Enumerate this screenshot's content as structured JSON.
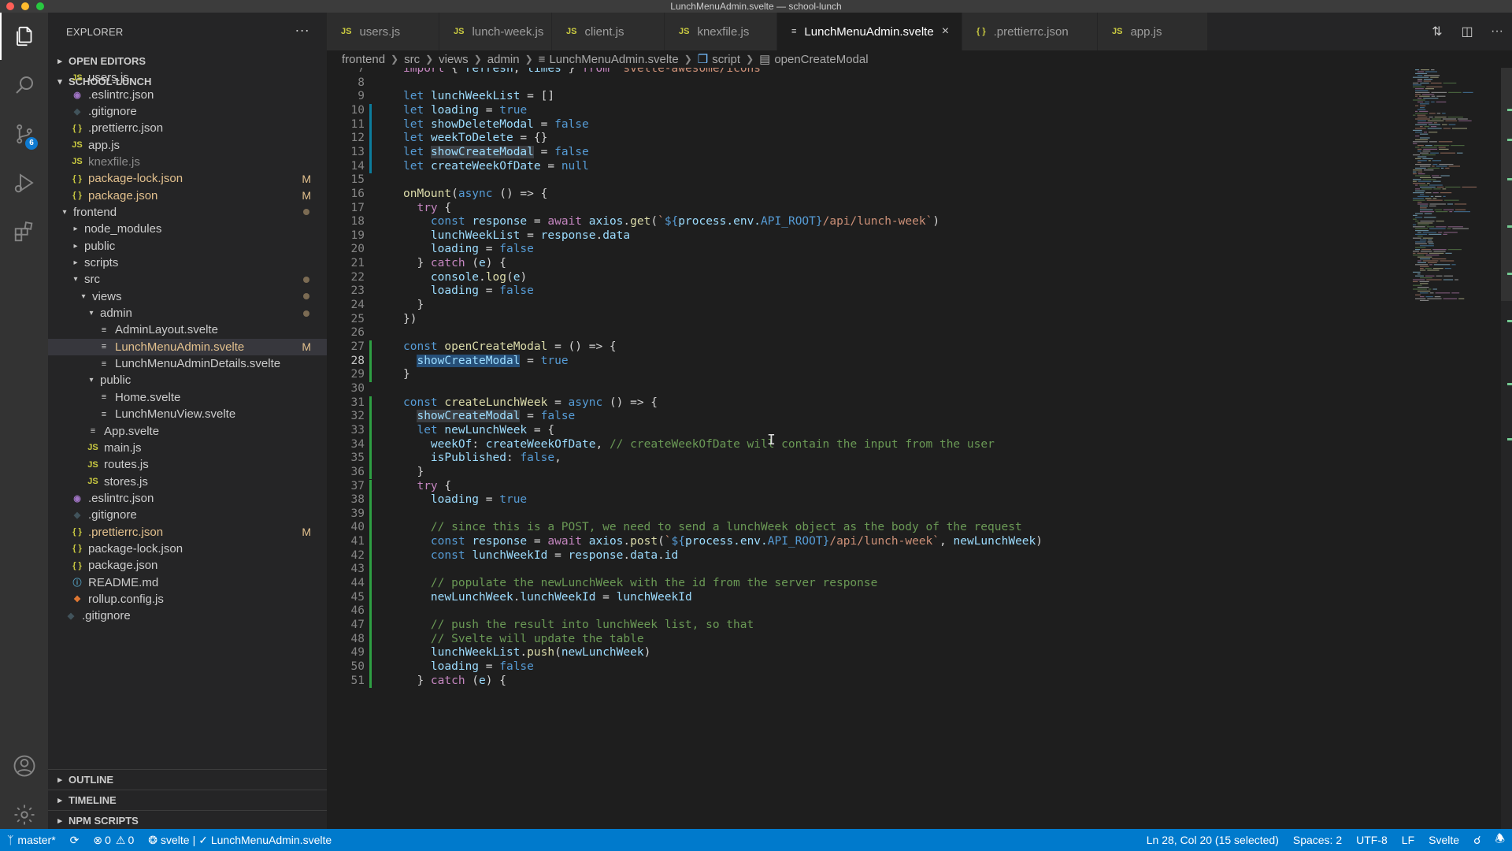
{
  "window": {
    "title": "LunchMenuAdmin.svelte — school-lunch"
  },
  "sidebar": {
    "title": "EXPLORER",
    "sections": {
      "open_editors": "OPEN EDITORS",
      "project": "SCHOOL-LUNCH",
      "outline": "OUTLINE",
      "timeline": "TIMELINE",
      "npm_scripts": "NPM SCRIPTS"
    },
    "tree": [
      {
        "label": "users.js",
        "icon": "js-icon",
        "mark": ""
      },
      {
        "label": ".eslintrc.json",
        "icon": "eslint-icon",
        "mark": ""
      },
      {
        "label": ".gitignore",
        "icon": "git-icon",
        "mark": ""
      },
      {
        "label": ".prettierrc.json",
        "icon": "json-icon",
        "mark": ""
      },
      {
        "label": "app.js",
        "icon": "js-icon",
        "mark": ""
      },
      {
        "label": "knexfile.js",
        "icon": "js-icon",
        "mark": ""
      },
      {
        "label": "package-lock.json",
        "icon": "json-icon",
        "mark": "M"
      },
      {
        "label": "package.json",
        "icon": "json-icon",
        "mark": "M"
      },
      {
        "label": "frontend",
        "icon": "folder",
        "mark": "dot"
      },
      {
        "label": "node_modules",
        "icon": "folder",
        "mark": ""
      },
      {
        "label": "public",
        "icon": "folder",
        "mark": ""
      },
      {
        "label": "scripts",
        "icon": "folder",
        "mark": ""
      },
      {
        "label": "src",
        "icon": "folder",
        "mark": "dot"
      },
      {
        "label": "views",
        "icon": "folder",
        "mark": "dot"
      },
      {
        "label": "admin",
        "icon": "folder",
        "mark": "dot"
      },
      {
        "label": "AdminLayout.svelte",
        "icon": "svelte-icon",
        "mark": ""
      },
      {
        "label": "LunchMenuAdmin.svelte",
        "icon": "svelte-icon",
        "mark": "M"
      },
      {
        "label": "LunchMenuAdminDetails.svelte",
        "icon": "svelte-icon",
        "mark": ""
      },
      {
        "label": "public",
        "icon": "folder",
        "mark": ""
      },
      {
        "label": "Home.svelte",
        "icon": "svelte-icon",
        "mark": ""
      },
      {
        "label": "LunchMenuView.svelte",
        "icon": "svelte-icon",
        "mark": ""
      },
      {
        "label": "App.svelte",
        "icon": "svelte-icon",
        "mark": ""
      },
      {
        "label": "main.js",
        "icon": "js-icon",
        "mark": ""
      },
      {
        "label": "routes.js",
        "icon": "js-icon",
        "mark": ""
      },
      {
        "label": "stores.js",
        "icon": "js-icon",
        "mark": ""
      },
      {
        "label": ".eslintrc.json",
        "icon": "eslint-icon",
        "mark": ""
      },
      {
        "label": ".gitignore",
        "icon": "git-icon",
        "mark": ""
      },
      {
        "label": ".prettierrc.json",
        "icon": "json-icon",
        "mark": "M"
      },
      {
        "label": "package-lock.json",
        "icon": "json-icon",
        "mark": ""
      },
      {
        "label": "package.json",
        "icon": "json-icon",
        "mark": ""
      },
      {
        "label": "README.md",
        "icon": "info-icon",
        "mark": ""
      },
      {
        "label": "rollup.config.js",
        "icon": "rollup-icon",
        "mark": ""
      },
      {
        "label": ".gitignore",
        "icon": "git-icon",
        "mark": ""
      }
    ],
    "modified_marker": "M"
  },
  "tabs": [
    {
      "label": "users.js",
      "icon": "JS"
    },
    {
      "label": "lunch-week.js",
      "icon": "JS"
    },
    {
      "label": "client.js",
      "icon": "JS"
    },
    {
      "label": "knexfile.js",
      "icon": "JS"
    },
    {
      "label": "LunchMenuAdmin.svelte",
      "icon": "svelte"
    },
    {
      "label": ".prettierrc.json",
      "icon": "{}"
    },
    {
      "label": "app.js",
      "icon": "JS"
    }
  ],
  "breadcrumb": [
    "frontend",
    "src",
    "views",
    "admin",
    "LunchMenuAdmin.svelte",
    "script",
    "openCreateModal"
  ],
  "editor": {
    "lines": [
      {
        "n": 7,
        "t": "import { refresh, times } from 'svelte-awesome/icons'"
      },
      {
        "n": 8,
        "t": ""
      },
      {
        "n": 9,
        "t": "let lunchWeekList = []"
      },
      {
        "n": 10,
        "t": "let loading = true"
      },
      {
        "n": 11,
        "t": "let showDeleteModal = false"
      },
      {
        "n": 12,
        "t": "let weekToDelete = {}"
      },
      {
        "n": 13,
        "t": "let showCreateModal = false"
      },
      {
        "n": 14,
        "t": "let createWeekOfDate = null"
      },
      {
        "n": 15,
        "t": ""
      },
      {
        "n": 16,
        "t": "onMount(async () => {"
      },
      {
        "n": 17,
        "t": "  try {"
      },
      {
        "n": 18,
        "t": "    const response = await axios.get(`${process.env.API_ROOT}/api/lunch-week`)"
      },
      {
        "n": 19,
        "t": "    lunchWeekList = response.data"
      },
      {
        "n": 20,
        "t": "    loading = false"
      },
      {
        "n": 21,
        "t": "  } catch (e) {"
      },
      {
        "n": 22,
        "t": "    console.log(e)"
      },
      {
        "n": 23,
        "t": "    loading = false"
      },
      {
        "n": 24,
        "t": "  }"
      },
      {
        "n": 25,
        "t": "})"
      },
      {
        "n": 26,
        "t": ""
      },
      {
        "n": 27,
        "t": "const openCreateModal = () => {"
      },
      {
        "n": 28,
        "t": "  showCreateModal = true"
      },
      {
        "n": 29,
        "t": "}"
      },
      {
        "n": 30,
        "t": ""
      },
      {
        "n": 31,
        "t": "const createLunchWeek = async () => {"
      },
      {
        "n": 32,
        "t": "  showCreateModal = false"
      },
      {
        "n": 33,
        "t": "  let newLunchWeek = {"
      },
      {
        "n": 34,
        "t": "    weekOf: createWeekOfDate, // createWeekOfDate will contain the input from the user"
      },
      {
        "n": 35,
        "t": "    isPublished: false,"
      },
      {
        "n": 36,
        "t": "  }"
      },
      {
        "n": 37,
        "t": "  try {"
      },
      {
        "n": 38,
        "t": "    loading = true"
      },
      {
        "n": 39,
        "t": ""
      },
      {
        "n": 40,
        "t": "    // since this is a POST, we need to send a lunchWeek object as the body of the request"
      },
      {
        "n": 41,
        "t": "    const response = await axios.post(`${process.env.API_ROOT}/api/lunch-week`, newLunchWeek)"
      },
      {
        "n": 42,
        "t": "    const lunchWeekId = response.data.id"
      },
      {
        "n": 43,
        "t": ""
      },
      {
        "n": 44,
        "t": "    // populate the newLunchWeek with the id from the server response"
      },
      {
        "n": 45,
        "t": "    newLunchWeek.lunchWeekId = lunchWeekId"
      },
      {
        "n": 46,
        "t": ""
      },
      {
        "n": 47,
        "t": "    // push the result into lunchWeek list, so that"
      },
      {
        "n": 48,
        "t": "    // Svelte will update the table"
      },
      {
        "n": 49,
        "t": "    lunchWeekList.push(newLunchWeek)"
      },
      {
        "n": 50,
        "t": "    loading = false"
      },
      {
        "n": 51,
        "t": "  } catch (e) {"
      }
    ],
    "current_line": 28
  },
  "statusbar": {
    "branch": "master*",
    "errors": "0",
    "warnings": "0",
    "svelte": "svelte",
    "check": "✓ LunchMenuAdmin.svelte",
    "cursor": "Ln 28, Col 20 (15 selected)",
    "spaces": "Spaces: 2",
    "encoding": "UTF-8",
    "eol": "LF",
    "language": "Svelte"
  },
  "colors": {
    "accent": "#007acc",
    "modified": "#e2c08d",
    "js": "#cbcb41",
    "svelte": "#d0d0d0"
  }
}
